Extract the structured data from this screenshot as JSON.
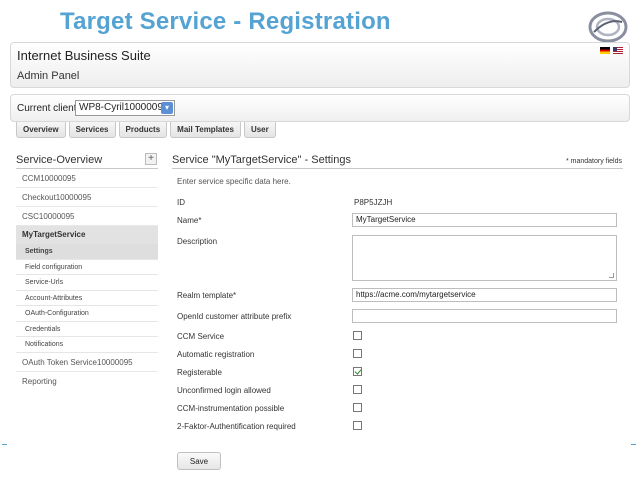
{
  "slide": {
    "title": "Target Service - Registration"
  },
  "header": {
    "suite_title": "Internet Business Suite",
    "subtitle": "Admin Panel",
    "flags": [
      "german-flag-icon",
      "english-flag-icon"
    ]
  },
  "client": {
    "label": "Current client:",
    "selected": "WP8-Cyril10000095"
  },
  "tabs": [
    {
      "label": "Overview"
    },
    {
      "label": "Services"
    },
    {
      "label": "Products"
    },
    {
      "label": "Mail Templates"
    },
    {
      "label": "User"
    }
  ],
  "sidebar": {
    "heading": "Service-Overview",
    "add_label": "+",
    "items": [
      {
        "label": "CCM10000095"
      },
      {
        "label": "Checkout10000095"
      },
      {
        "label": "CSC10000095"
      },
      {
        "label": "MyTargetService"
      }
    ],
    "subitems": [
      {
        "label": "Settings"
      },
      {
        "label": "Field configuration"
      },
      {
        "label": "Service-Urls"
      },
      {
        "label": "Account-Attributes"
      },
      {
        "label": "OAuth-Configuration"
      },
      {
        "label": "Credentials"
      },
      {
        "label": "Notifications"
      }
    ],
    "after_items": [
      {
        "label": "OAuth Token Service10000095"
      },
      {
        "label": "Reporting"
      }
    ]
  },
  "main": {
    "heading": "Service \"MyTargetService\" - Settings",
    "mandatory_note": "* mandatory fields",
    "intro": "Enter service specific data here.",
    "fields": {
      "id_label": "ID",
      "id_value": "P8P5JZJH",
      "name_label": "Name*",
      "name_value": "MyTargetService",
      "description_label": "Description",
      "realm_label": "Realm template*",
      "realm_value": "https://acme.com/mytargetservice",
      "openid_label": "OpenId customer attribute prefix",
      "openid_value": ""
    },
    "checkboxes": [
      {
        "label": "CCM Service",
        "checked": false
      },
      {
        "label": "Automatic registration",
        "checked": false
      },
      {
        "label": "Registerable",
        "checked": true
      },
      {
        "label": "Unconfirmed login allowed",
        "checked": false
      },
      {
        "label": "CCM-instrumentation possible",
        "checked": false
      },
      {
        "label": "2-Faktor-Authentification required",
        "checked": false
      }
    ],
    "save_label": "Save"
  },
  "colors": {
    "title_blue": "#55a3d3",
    "check_green": "#2a8a2a",
    "select_blue": "#5b8fd6"
  }
}
